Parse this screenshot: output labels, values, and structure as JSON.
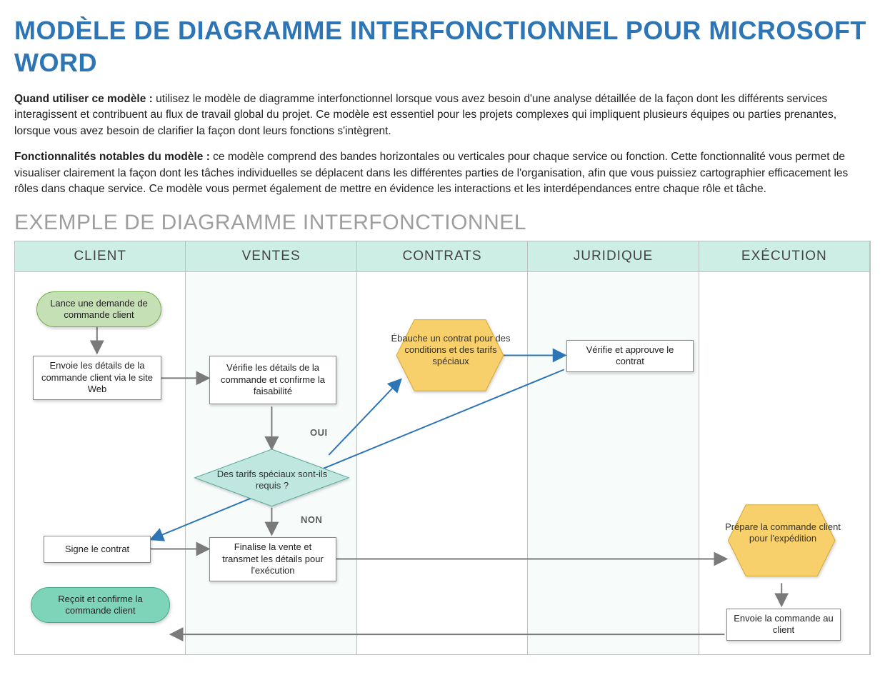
{
  "title": "MODÈLE DE DIAGRAMME INTERFONCTIONNEL POUR MICROSOFT WORD",
  "paragraph1_bold": "Quand utiliser ce modèle :",
  "paragraph1_text": " utilisez le modèle de diagramme interfonctionnel lorsque vous avez besoin d'une analyse détaillée de la façon dont les différents services interagissent et contribuent au flux de travail global du projet. Ce modèle est essentiel pour les projets complexes qui impliquent plusieurs équipes ou parties prenantes, lorsque vous avez besoin de clarifier la façon dont leurs fonctions s'intègrent.",
  "paragraph2_bold": "Fonctionnalités notables du modèle :",
  "paragraph2_text": " ce modèle comprend des bandes horizontales ou verticales pour chaque service ou fonction. Cette fonctionnalité vous permet de visualiser clairement la façon dont les tâches individuelles se déplacent dans les différentes parties de l'organisation, afin que vous puissiez cartographier efficacement les rôles dans chaque service. Ce modèle vous permet également de mettre en évidence les interactions et les interdépendances entre chaque rôle et tâche.",
  "subtitle": "EXEMPLE DE DIAGRAMME INTERFONCTIONNEL",
  "lanes": {
    "client": "CLIENT",
    "ventes": "VENTES",
    "contrats": "CONTRATS",
    "juridique": "JURIDIQUE",
    "execution": "EXÉCUTION"
  },
  "nodes": {
    "start": "Lance une demande de commande client",
    "send_details": "Envoie les détails de la commande client via le site Web",
    "verify": "Vérifie les détails de la commande et confirme la faisabilité",
    "decision": "Des tarifs spéciaux sont-ils requis ?",
    "draft": "Ébauche un contrat pour des conditions et des tarifs spéciaux",
    "approve": "Vérifie et approuve le contrat",
    "sign": "Signe le contrat",
    "finalize": "Finalise la vente et transmet les détails pour l'exécution",
    "prepare": "Prépare la commande client pour l'expédition",
    "ship": "Envoie la commande au client",
    "receive": "Reçoit et confirme la commande client"
  },
  "labels": {
    "yes": "OUI",
    "no": "NON"
  },
  "colors": {
    "accent_blue": "#2e75b6",
    "lane_header": "#cdeee5",
    "decision_fill": "#bfe6df",
    "hex_fill": "#f7cf6b",
    "term_green": "#c5e0b4",
    "term_teal": "#7dd4b8",
    "arrow_gray": "#7a7a7a",
    "arrow_blue": "#2e75b6"
  }
}
